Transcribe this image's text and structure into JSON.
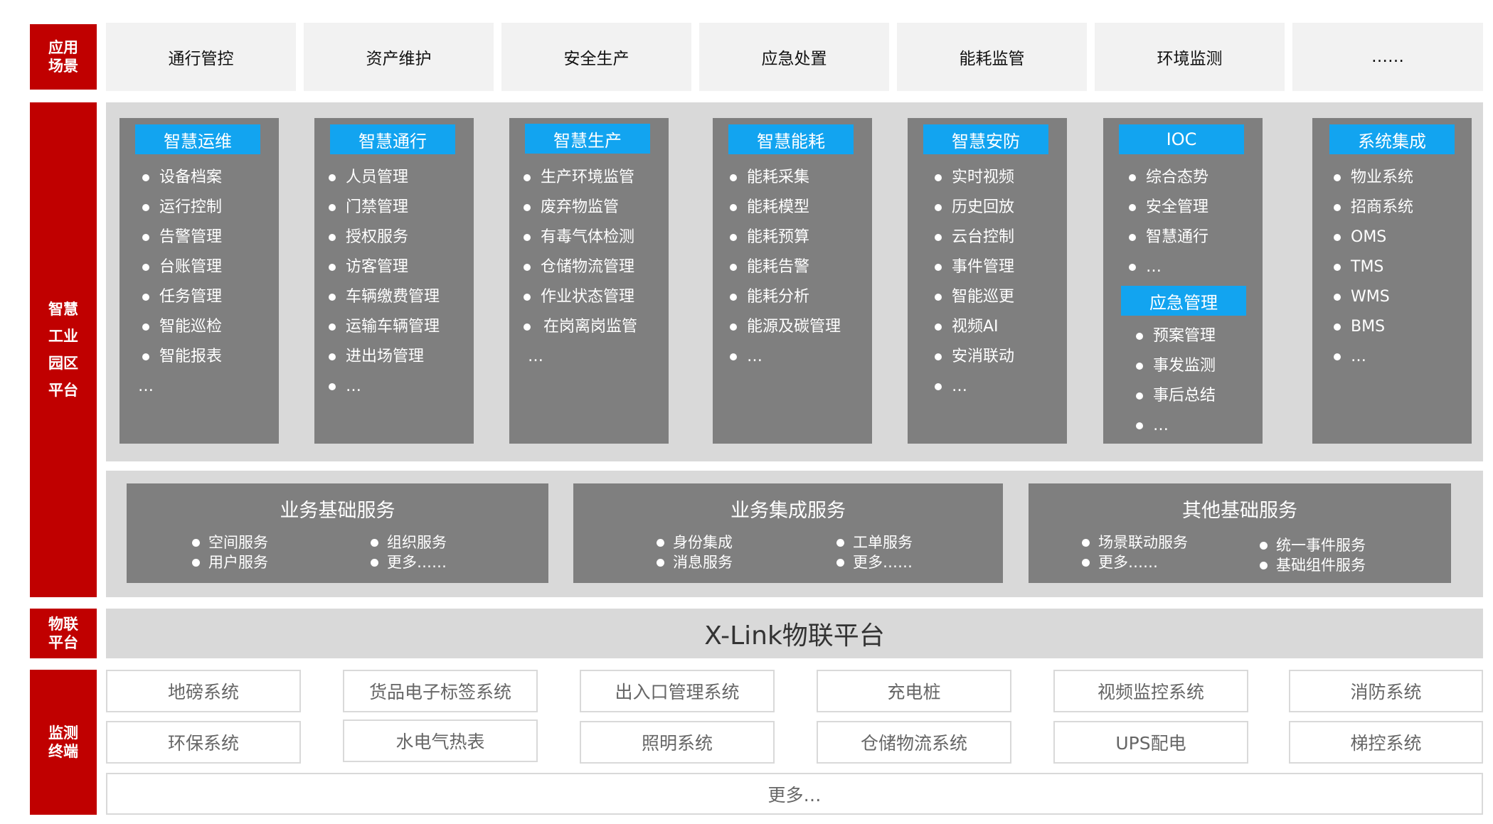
{
  "layers": {
    "application": [
      "应用",
      "场景"
    ],
    "platform": [
      "智慧",
      "工业",
      "园区",
      "平台"
    ],
    "iot": [
      "物联",
      "平台"
    ],
    "terminal": [
      "监测",
      "终端"
    ]
  },
  "scenarios": [
    "通行管控",
    "资产维护",
    "安全生产",
    "应急处置",
    "能耗监管",
    "环境监测",
    "……"
  ],
  "modules": [
    {
      "title": "智慧运维",
      "items": [
        "设备档案",
        "运行控制",
        "告警管理",
        "台账管理",
        "任务管理",
        "智能巡检",
        "智能报表"
      ],
      "tail": "…"
    },
    {
      "title": "智慧通行",
      "items": [
        "人员管理",
        "门禁管理",
        "授权服务",
        "访客管理",
        "车辆缴费管理",
        "运输车辆管理",
        "进出场管理",
        "…"
      ]
    },
    {
      "title": "智慧生产",
      "items": [
        "生产环境监管",
        "废弃物监管",
        "有毒气体检测",
        "仓储物流管理",
        "作业状态管理",
        "在岗离岗监管"
      ],
      "tail": "…"
    },
    {
      "title": "智慧能耗",
      "items": [
        "能耗采集",
        "能耗模型",
        "能耗预算",
        "能耗告警",
        "能耗分析",
        "能源及碳管理",
        "…"
      ]
    },
    {
      "title": "智慧安防",
      "items": [
        "实时视频",
        "历史回放",
        "云台控制",
        "事件管理",
        "智能巡更",
        "视频AI",
        "安消联动",
        "…"
      ]
    },
    {
      "title": "IOC",
      "items": [
        "综合态势",
        "安全管理",
        "智慧通行",
        "…"
      ],
      "sub_title": "应急管理",
      "sub_items": [
        "预案管理",
        "事发监测",
        "事后总结",
        "…"
      ]
    },
    {
      "title": "系统集成",
      "items": [
        "物业系统",
        "招商系统",
        "OMS",
        "TMS",
        "WMS",
        "BMS",
        "…"
      ]
    }
  ],
  "services": [
    {
      "title": "业务基础服务",
      "col1": [
        "空间服务",
        "用户服务"
      ],
      "col2": [
        "组织服务",
        "更多……"
      ]
    },
    {
      "title": "业务集成服务",
      "col1": [
        "身份集成",
        "消息服务"
      ],
      "col2": [
        "工单服务",
        "更多……"
      ]
    },
    {
      "title": "其他基础服务",
      "col1": [
        "场景联动服务",
        "更多……"
      ],
      "col2": [
        "统一事件服务",
        "基础组件服务"
      ]
    }
  ],
  "iot_platform": "X-Link物联平台",
  "terminals": {
    "row1": [
      "地磅系统",
      "货品电子标签系统",
      "出入口管理系统",
      "充电桩",
      "视频监控系统",
      "消防系统"
    ],
    "row2": [
      "环保系统",
      "水电气热表",
      "照明系统",
      "仓储物流系统",
      "UPS配电",
      "梯控系统"
    ],
    "more": "更多…"
  },
  "colors": {
    "accent_red": "#c00000",
    "module_header_blue": "#12a4f0",
    "module_grey": "#7f7f7f",
    "panel_grey": "#d9d9d9"
  }
}
